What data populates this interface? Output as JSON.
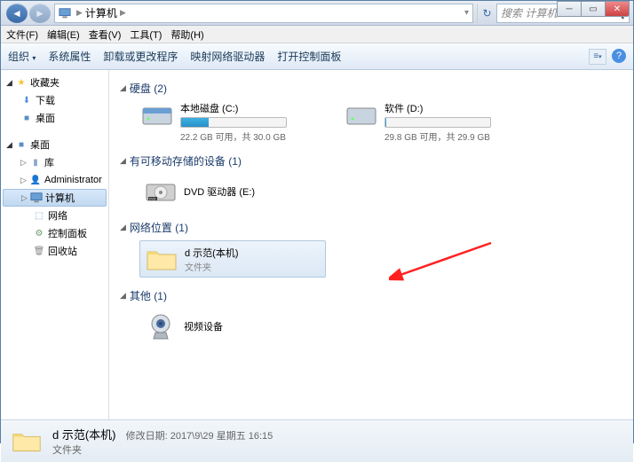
{
  "window": {
    "min": "─",
    "max": "▭",
    "close": "✕"
  },
  "breadcrumb": {
    "root_icon": "■",
    "item": "计算机"
  },
  "search": {
    "placeholder": "搜索 计算机"
  },
  "menus": {
    "file": "文件(F)",
    "edit": "编辑(E)",
    "view": "查看(V)",
    "tools": "工具(T)",
    "help": "帮助(H)"
  },
  "toolbar": {
    "organize": "组织",
    "properties": "系统属性",
    "uninstall": "卸载或更改程序",
    "map": "映射网络驱动器",
    "panel": "打开控制面板"
  },
  "sidebar": {
    "favorites": "收藏夹",
    "downloads": "下载",
    "desktop_fav": "桌面",
    "desktop": "桌面",
    "libraries": "库",
    "admin": "Administrator",
    "computer": "计算机",
    "network": "网络",
    "control": "控制面板",
    "recycle": "回收站"
  },
  "sections": {
    "drives": {
      "title": "硬盘",
      "count": "(2)"
    },
    "removable": {
      "title": "有可移动存储的设备",
      "count": "(1)"
    },
    "netloc": {
      "title": "网络位置",
      "count": "(1)"
    },
    "other": {
      "title": "其他",
      "count": "(1)"
    }
  },
  "drive_c": {
    "name": "本地磁盘 (C:)",
    "text": "22.2 GB 可用，共 30.0 GB",
    "fill": 26
  },
  "drive_d": {
    "name": "软件 (D:)",
    "text": "29.8 GB 可用，共 29.9 GB",
    "fill": 1
  },
  "dvd": {
    "name": "DVD 驱动器 (E:)"
  },
  "netfolder": {
    "name": "d 示范(本机)",
    "type": "文件夹"
  },
  "other_item": {
    "name": "视频设备"
  },
  "statusbar": {
    "name": "d 示范(本机)",
    "meta_label": "修改日期:",
    "meta_value": "2017\\9\\29 星期五 16:15",
    "type": "文件夹"
  }
}
